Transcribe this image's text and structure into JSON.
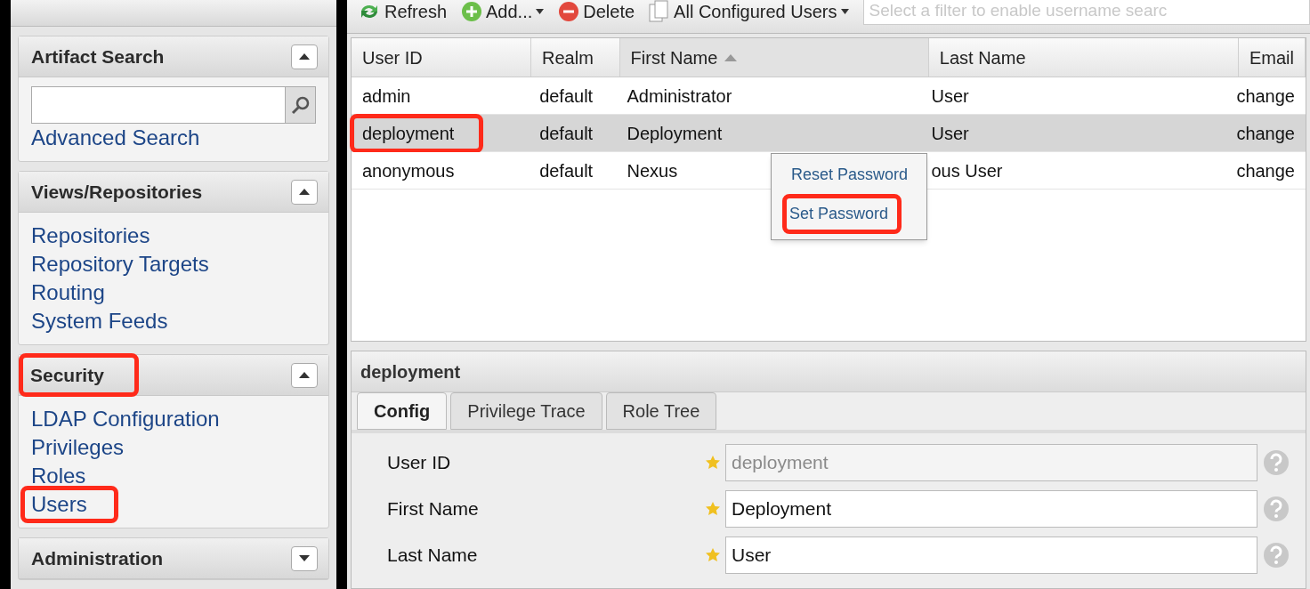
{
  "toolbar": [
    {
      "kind": "refresh",
      "label": "Refresh"
    },
    {
      "kind": "add",
      "label": "Add..."
    },
    {
      "kind": "delete",
      "label": "Delete"
    },
    {
      "kind": "view",
      "label": "All Configured Users"
    }
  ],
  "filter": {
    "placeholder": "Select a filter to enable username searc"
  },
  "sidebar": {
    "sections": [
      {
        "kind": "search",
        "title": "Artifact Search",
        "expanded": true,
        "highlighted": false,
        "links": [
          {
            "label": "Advanced Search",
            "highlighted": false
          }
        ]
      },
      {
        "kind": "links",
        "title": "Views/Repositories",
        "expanded": true,
        "highlighted": false,
        "links": [
          {
            "label": "Repositories",
            "highlighted": false
          },
          {
            "label": "Repository Targets",
            "highlighted": false
          },
          {
            "label": "Routing",
            "highlighted": false
          },
          {
            "label": "System Feeds",
            "highlighted": false
          }
        ]
      },
      {
        "kind": "links",
        "title": "Security",
        "expanded": true,
        "highlighted": true,
        "links": [
          {
            "label": "LDAP Configuration",
            "highlighted": false
          },
          {
            "label": "Privileges",
            "highlighted": false
          },
          {
            "label": "Roles",
            "highlighted": false
          },
          {
            "label": "Users",
            "highlighted": true
          }
        ]
      },
      {
        "kind": "links",
        "title": "Administration",
        "expanded": false,
        "highlighted": false
      }
    ]
  },
  "table": {
    "columns": [
      {
        "label": "User ID",
        "sorted": false
      },
      {
        "label": "Realm",
        "sorted": false
      },
      {
        "label": "First Name",
        "sorted": true
      },
      {
        "label": "Last Name",
        "sorted": false
      },
      {
        "label": "Email",
        "sorted": false
      }
    ],
    "rows": [
      {
        "selected": false,
        "highlighted": false,
        "cells": [
          "admin",
          "default",
          "Administrator",
          "User",
          "change"
        ]
      },
      {
        "selected": true,
        "highlighted": true,
        "cells": [
          "deployment",
          "default",
          "Deployment",
          "User",
          "change"
        ]
      },
      {
        "selected": false,
        "highlighted": false,
        "cells": [
          "anonymous",
          "default",
          "Nexus",
          "ous User",
          "change"
        ]
      }
    ]
  },
  "context_menu": {
    "items": [
      {
        "label": "Reset Password",
        "highlighted": false
      },
      {
        "label": "Set Password",
        "highlighted": true
      }
    ]
  },
  "details": {
    "title": "deployment",
    "tabs": [
      {
        "label": "Config",
        "selected": true
      },
      {
        "label": "Privilege Trace",
        "selected": false
      },
      {
        "label": "Role Tree",
        "selected": false
      }
    ],
    "fields": [
      {
        "label": "User ID",
        "value": "deployment",
        "required": true,
        "disabled": true
      },
      {
        "label": "First Name",
        "value": "Deployment",
        "required": true,
        "disabled": false
      },
      {
        "label": "Last Name",
        "value": "User",
        "required": true,
        "disabled": false
      }
    ]
  }
}
